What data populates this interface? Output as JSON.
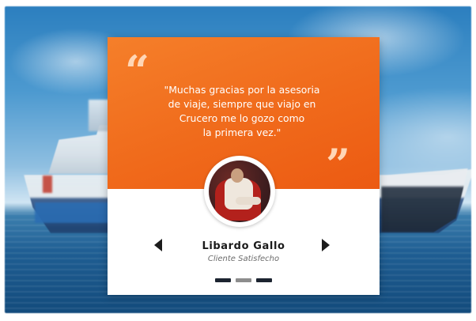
{
  "testimonial": {
    "quote_open_glyph": "“",
    "quote_close_glyph": "”",
    "text": "\"Muchas gracias por la asesoria\nde viaje, siempre que viajo en\nCrucero me lo gozo como\nla primera vez.\"",
    "name": "Libardo Gallo",
    "role": "Cliente Satisfecho"
  },
  "icons": {
    "prev": "arrow-left-icon",
    "next": "arrow-right-icon",
    "quote": "quote-icon"
  },
  "pagination": {
    "count": 3,
    "active_index": 1
  },
  "colors": {
    "accent_orange": "#f06a1b",
    "dot_dark": "#1c2430",
    "dot_light": "#8d8d8d"
  }
}
